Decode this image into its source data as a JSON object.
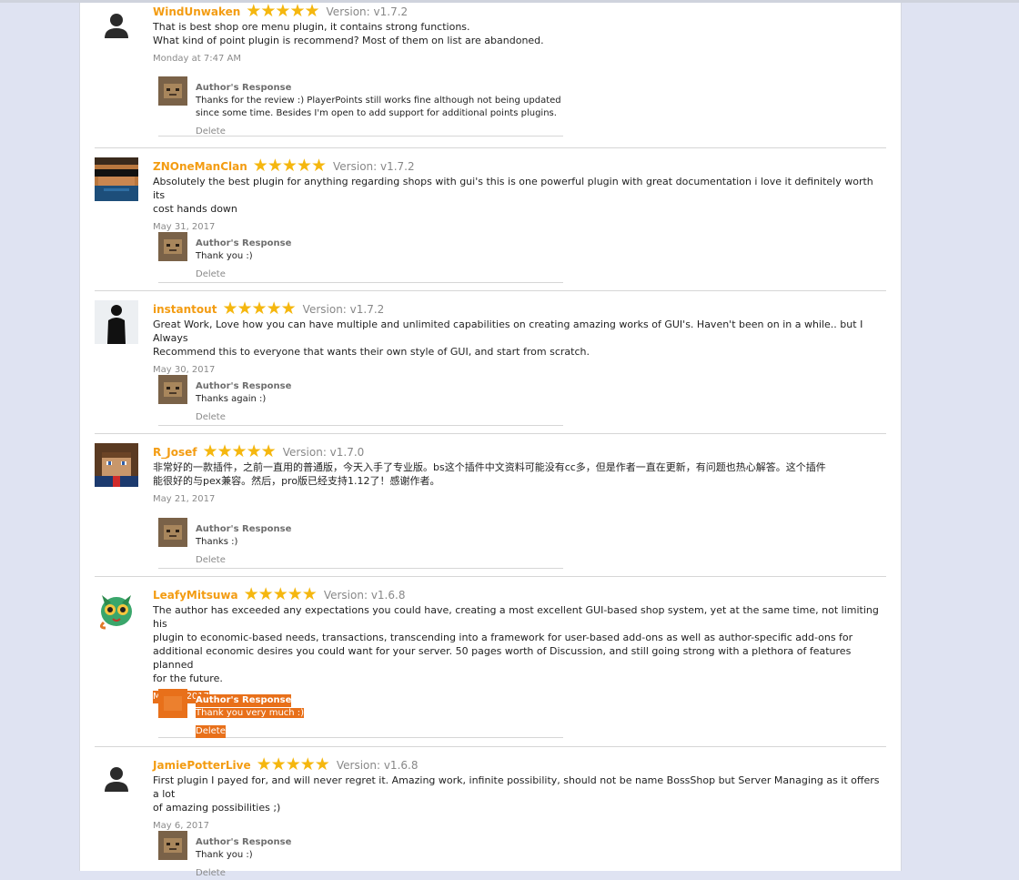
{
  "colors": {
    "accent_username": "#f39c12",
    "star": "#f5b70f",
    "selection": "#e8701a",
    "page_bg": "#dfe3f2"
  },
  "icons": {
    "star": "★",
    "default_avatar": "person-silhouette-icon"
  },
  "response_title": "Author's Response",
  "delete_label": "Delete",
  "reviews": [
    {
      "username": "WindUnwaken",
      "rating": 5,
      "version": "Version: v1.7.2",
      "text_lines": [
        "That is best shop ore menu plugin, it contains strong functions.",
        "What kind of point plugin is recommend? Most of them on list are abandoned."
      ],
      "date": "Monday at 7:47 AM",
      "response_lines": [
        "Thanks for the review :) PlayerPoints still works fine although not being updated",
        "since some time. Besides I'm open to add support for additional points plugins."
      ]
    },
    {
      "username": "ZNOneManClan",
      "rating": 5,
      "version": "Version: v1.7.2",
      "text_lines": [
        "Absolutely the best plugin for anything regarding shops with gui's this is one powerful plugin with great documentation i love it definitely worth its",
        "cost hands down"
      ],
      "date": "May 31, 2017",
      "response_lines": [
        "Thank you :)"
      ]
    },
    {
      "username": "instantout",
      "rating": 5,
      "version": "Version: v1.7.2",
      "text_lines": [
        "Great Work, Love how you can have multiple and unlimited capabilities on creating amazing works of GUI's. Haven't been on in a while.. but I Always",
        "Recommend this to everyone that wants their own style of GUI, and start from scratch."
      ],
      "date": "May 30, 2017",
      "response_lines": [
        "Thanks again :)"
      ]
    },
    {
      "username": "R_Josef",
      "rating": 5,
      "version": "Version: v1.7.0",
      "text_lines": [
        "非常好的一款插件，之前一直用的普通版，今天入手了专业版。bs这个插件中文资料可能没有cc多，但是作者一直在更新，有问题也热心解答。这个插件",
        "能很好的与pex兼容。然后，pro版已经支持1.12了！感谢作者。"
      ],
      "date": "May 21, 2017",
      "response_lines": [
        "Thanks :)"
      ]
    },
    {
      "username": "LeafyMitsuwa",
      "rating": 5,
      "version": "Version: v1.6.8",
      "text_lines": [
        "The author has exceeded any expectations you could have, creating a most excellent GUI-based shop system, yet at the same time, not limiting his",
        "plugin to economic-based needs, transactions, transcending into a framework for user-based add-ons as well as author-specific add-ons for",
        "additional economic desires you could want for your server. 50 pages worth of Discussion, and still going strong with a plethora of features planned",
        "for the future."
      ],
      "date": "May 6, 2017",
      "response_lines": [
        "Thank you very much :)"
      ]
    },
    {
      "username": "JamiePotterLive",
      "rating": 5,
      "version": "Version: v1.6.8",
      "text_lines": [
        "First plugin I payed for, and will never regret it. Amazing work, infinite possibility, should not be name BossShop but Server Managing as it offers a lot",
        "of amazing possibilities ;)"
      ],
      "date": "May 6, 2017",
      "response_lines": [
        "Thank you :)"
      ]
    }
  ]
}
